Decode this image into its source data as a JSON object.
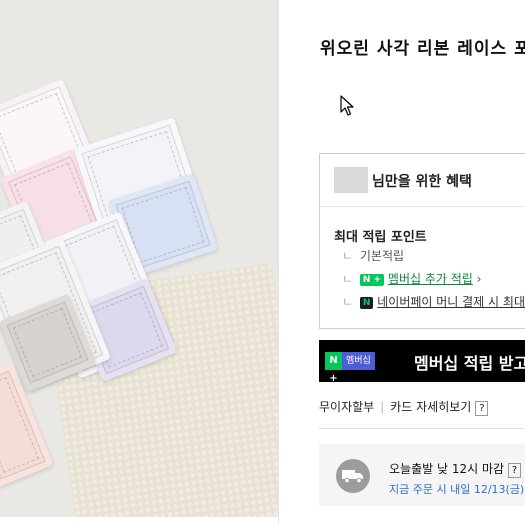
{
  "product": {
    "title": "위오린 사각 리본 레이스 포"
  },
  "benefit": {
    "heading": "님만을 위한 혜택",
    "points_title": "최대 적립 포인트",
    "branch_glyph": "ㄴ",
    "basic": "기본적립",
    "membership_badge": "N +",
    "membership_link": "멤버십 추가 적립",
    "membership_arrow": "›",
    "npay_badge": "N",
    "npay_link": "네이버페이 머니 결제 시 최대"
  },
  "membership_bar": {
    "badge_n": "N +",
    "badge_label": "멤버십",
    "text": "멤버십 적립 받고"
  },
  "payment": {
    "interest_free": "무이자할부",
    "separator": "|",
    "card_details": "카드 자세히보기",
    "help": "?"
  },
  "shipping": {
    "line1": "오늘출발 낮 12시 마감",
    "help": "?",
    "line2": "지금 주문 시 내일 12/13(금)"
  },
  "colors": {
    "npay_green": "#03c75a",
    "member_blue": "#4e5dd8",
    "link_blue": "#2e6fd1"
  }
}
